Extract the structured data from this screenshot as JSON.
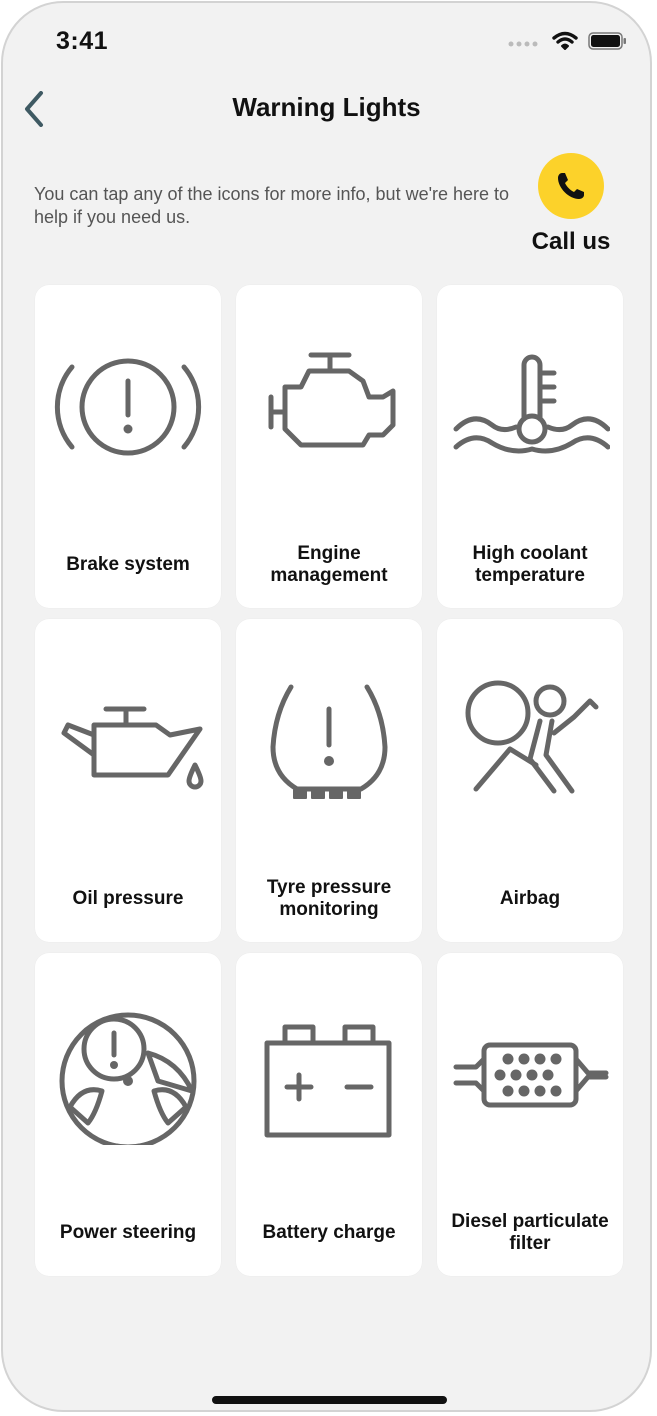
{
  "status_bar": {
    "time": "3:41"
  },
  "header": {
    "title": "Warning Lights"
  },
  "intro": {
    "text": "You can tap any of the icons for more info, but we're here to help if you need us."
  },
  "call": {
    "label": "Call us",
    "color": "#fcd22a",
    "icon": "phone-icon"
  },
  "warning_lights": [
    {
      "label": "Brake system",
      "icon": "brake-system-icon"
    },
    {
      "label": "Engine management",
      "icon": "engine-icon"
    },
    {
      "label": "High coolant temperature",
      "icon": "coolant-temperature-icon"
    },
    {
      "label": "Oil pressure",
      "icon": "oil-can-icon"
    },
    {
      "label": "Tyre pressure monitoring",
      "icon": "tyre-pressure-icon"
    },
    {
      "label": "Airbag",
      "icon": "airbag-icon"
    },
    {
      "label": "Power steering",
      "icon": "steering-wheel-icon"
    },
    {
      "label": "Battery charge",
      "icon": "battery-icon"
    },
    {
      "label": "Diesel particulate filter",
      "icon": "particulate-filter-icon"
    }
  ]
}
